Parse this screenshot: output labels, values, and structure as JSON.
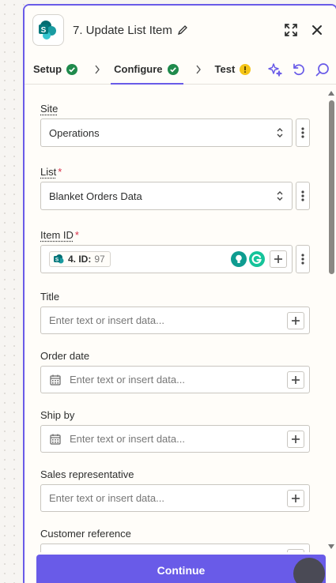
{
  "header": {
    "title": "7. Update List Item",
    "app_icon": "sharepoint-logo",
    "expand_icon": "expand-icon",
    "close_icon": "close-icon"
  },
  "tabs": [
    {
      "label": "Setup",
      "status": "complete"
    },
    {
      "label": "Configure",
      "status": "complete"
    },
    {
      "label": "Test",
      "status": "warning"
    }
  ],
  "tab_tools": [
    "sparkle-icon",
    "refresh-icon",
    "search-icon"
  ],
  "fields": {
    "site": {
      "label": "Site",
      "value": "Operations"
    },
    "list": {
      "label": "List",
      "required_mark": "*",
      "value": "Blanket Orders Data"
    },
    "item_id": {
      "label": "Item ID",
      "required_mark": "*",
      "pill_label": "4. ID:",
      "pill_value": "97"
    },
    "title": {
      "label": "Title",
      "placeholder": "Enter text or insert data..."
    },
    "order_date": {
      "label": "Order date",
      "placeholder": "Enter text or insert data..."
    },
    "ship_by": {
      "label": "Ship by",
      "placeholder": "Enter text or insert data..."
    },
    "sales_rep": {
      "label": "Sales representative",
      "placeholder": "Enter text or insert data..."
    },
    "customer_ref": {
      "label": "Customer reference"
    }
  },
  "footer": {
    "continue_label": "Continue"
  },
  "colors": {
    "accent": "#695be8",
    "success": "#1f8a4c",
    "warning": "#f5c518",
    "sharepoint": "#038387"
  }
}
